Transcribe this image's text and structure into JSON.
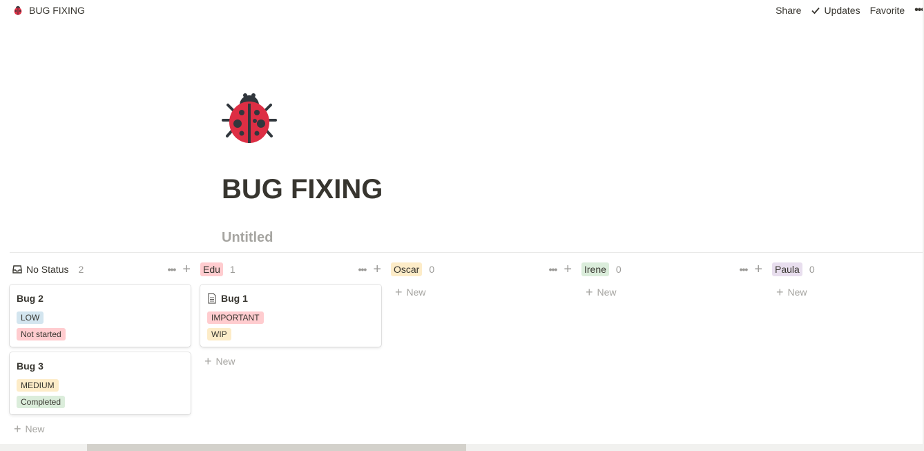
{
  "topbar": {
    "breadcrumb": "BUG FIXING",
    "share": "Share",
    "updates": "Updates",
    "favorite": "Favorite",
    "more": "•••"
  },
  "page": {
    "title": "BUG FIXING",
    "view_name": "Untitled"
  },
  "board": {
    "new_label": "New",
    "columns": [
      {
        "name": "No Status",
        "count": "2",
        "color": "",
        "cards": [
          {
            "title": "Bug 2",
            "tags": [
              {
                "label": "LOW",
                "color": "#d3e5ef"
              },
              {
                "label": "Not started",
                "color": "#ffcccf"
              }
            ]
          },
          {
            "title": "Bug 3",
            "tags": [
              {
                "label": "MEDIUM",
                "color": "#fdecc8"
              },
              {
                "label": "Completed",
                "color": "#dbeddb"
              }
            ]
          }
        ]
      },
      {
        "name": "Edu",
        "count": "1",
        "color": "#ffcccf",
        "cards": [
          {
            "title": "Bug 1",
            "tags": [
              {
                "label": "IMPORTANT",
                "color": "#ffcccf"
              },
              {
                "label": "WIP",
                "color": "#fdecc8"
              }
            ]
          }
        ]
      },
      {
        "name": "Oscar",
        "count": "0",
        "color": "#fdecc8",
        "cards": []
      },
      {
        "name": "Irene",
        "count": "0",
        "color": "#dbeddb",
        "cards": []
      },
      {
        "name": "Paula",
        "count": "0",
        "color": "#e8deee",
        "cards": []
      }
    ]
  }
}
